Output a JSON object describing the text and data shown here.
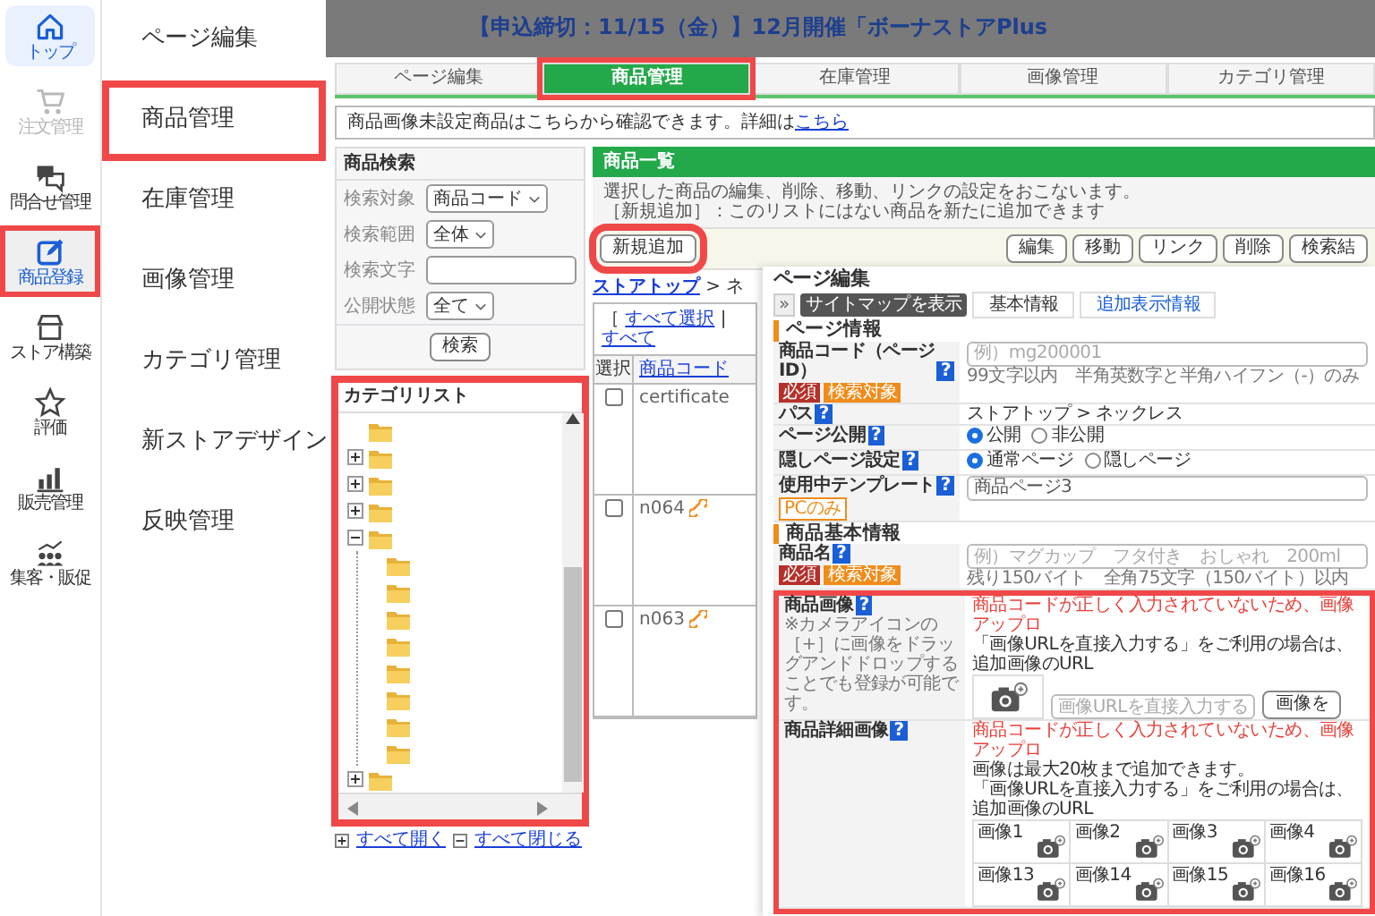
{
  "sidebar": {
    "items": [
      {
        "label": "トップ",
        "selected": true,
        "disabled": false,
        "highlighted": false
      },
      {
        "label": "注文管理",
        "selected": false,
        "disabled": true,
        "highlighted": false
      },
      {
        "label": "問合せ管理",
        "selected": false,
        "disabled": false,
        "highlighted": false
      },
      {
        "label": "商品登録",
        "selected": false,
        "disabled": false,
        "highlighted": true
      },
      {
        "label": "ストア構築",
        "selected": false,
        "disabled": false,
        "highlighted": false
      },
      {
        "label": "評価",
        "selected": false,
        "disabled": false,
        "highlighted": false
      },
      {
        "label": "販売管理",
        "selected": false,
        "disabled": false,
        "highlighted": false
      },
      {
        "label": "集客・販促",
        "selected": false,
        "disabled": false,
        "highlighted": false
      }
    ]
  },
  "submenu": {
    "items": [
      {
        "label": "ページ編集",
        "highlighted": false
      },
      {
        "label": "商品管理",
        "highlighted": true
      },
      {
        "label": "在庫管理",
        "highlighted": false
      },
      {
        "label": "画像管理",
        "highlighted": false
      },
      {
        "label": "カテゴリ管理",
        "highlighted": false
      },
      {
        "label": "新ストアデザイン",
        "highlighted": false
      },
      {
        "label": "反映管理",
        "highlighted": false
      }
    ]
  },
  "banner": {
    "text": "【申込締切：11/15（金）】12月開催「ボーナストアPlus"
  },
  "product_window": {
    "tabs": [
      {
        "label": "ページ編集",
        "selected": false,
        "highlighted": false
      },
      {
        "label": "商品管理",
        "selected": true,
        "highlighted": true
      },
      {
        "label": "在庫管理",
        "selected": false,
        "highlighted": false
      },
      {
        "label": "画像管理",
        "selected": false,
        "highlighted": false
      },
      {
        "label": "カテゴリ管理",
        "selected": false,
        "highlighted": false
      }
    ],
    "notice": {
      "text": "商品画像未設定商品はこちらから確認できます。詳細は",
      "link": "こちら"
    },
    "search": {
      "title": "商品検索",
      "fields": [
        {
          "label": "検索対象",
          "kind": "select",
          "value": "商品コード"
        },
        {
          "label": "検索範囲",
          "kind": "select",
          "value": "全体"
        },
        {
          "label": "検索文字",
          "kind": "text"
        },
        {
          "label": "公開状態",
          "kind": "select",
          "value": "全て"
        }
      ],
      "button": "検索"
    },
    "category_list": {
      "title": "カテゴリリスト",
      "highlighted": true,
      "tree": [
        {
          "expandable": false
        },
        {
          "expandable": true,
          "expanded": false
        },
        {
          "expandable": true,
          "expanded": false
        },
        {
          "expandable": true,
          "expanded": false
        },
        {
          "expandable": true,
          "expanded": true,
          "children": [
            {
              "expandable": false
            },
            {
              "expandable": false
            },
            {
              "expandable": false
            },
            {
              "expandable": false
            },
            {
              "expandable": false
            },
            {
              "expandable": false
            },
            {
              "expandable": false
            },
            {
              "expandable": false
            }
          ]
        },
        {
          "expandable": true,
          "expanded": false
        }
      ],
      "expand_all": "すべて開く",
      "collapse_all": "すべて閉じる"
    },
    "product_list": {
      "title": "商品一覧",
      "description": [
        "選択した商品の編集、削除、移動、リンクの設定をおこないます。",
        "［新規追加］：このリストにはない商品を新たに追加できます"
      ],
      "add_button": {
        "label": "新規追加",
        "highlighted": true
      },
      "actions": [
        "編集",
        "移動",
        "リンク",
        "削除",
        "検索結"
      ],
      "breadcrumb": {
        "link": "ストアトップ",
        "rest": "> ネ"
      },
      "select_bracket": "［",
      "select_links": [
        "すべて選択",
        "すべて"
      ],
      "separator": "|",
      "columns": [
        "選択",
        "商品コード"
      ],
      "rows": [
        {
          "code": "certificate",
          "checked": false,
          "linked": false
        },
        {
          "code": "n064",
          "checked": false,
          "linked": true
        },
        {
          "code": "n063",
          "checked": false,
          "linked": true
        }
      ]
    }
  },
  "page_edit": {
    "title": "ページ編集",
    "sitemap_button": "»",
    "tooltip": "サイトマップを表示",
    "tabs": [
      {
        "label": "基本情報",
        "selected": true
      },
      {
        "label": "追加表示情報",
        "selected": false
      }
    ],
    "sections": [
      {
        "title": "ページ情報",
        "rows": [
          {
            "kind": "input",
            "label": "商品コード（ページID）",
            "help": "?",
            "badges": [
              {
                "text": "必須",
                "color": "#b5302a",
                "outline": false
              },
              {
                "text": "検索対象",
                "color": "#f08c1a",
                "outline": false
              }
            ],
            "placeholder": "例）mg200001",
            "hint": "99文字以内　半角英数字と半角ハイフン（-）のみ",
            "highlighted": false
          },
          {
            "kind": "text",
            "label": "パス",
            "help": "?",
            "value": "ストアトップ > ネックレス",
            "highlighted": false
          },
          {
            "kind": "radio",
            "label": "ページ公開",
            "help": "?",
            "options": [
              {
                "label": "公開",
                "selected": true
              },
              {
                "label": "非公開",
                "selected": false
              }
            ],
            "highlighted": false
          },
          {
            "kind": "radio",
            "label": "隠しページ設定",
            "help": "?",
            "options": [
              {
                "label": "通常ページ",
                "selected": true
              },
              {
                "label": "隠しページ",
                "selected": false
              }
            ],
            "highlighted": false
          },
          {
            "kind": "select",
            "label": "使用中テンプレート",
            "help": "?",
            "badges": [
              {
                "text": "PCのみ",
                "color": "#f08c1a",
                "outline": true
              }
            ],
            "value": "商品ページ3",
            "highlighted": false
          }
        ]
      },
      {
        "title": "商品基本情報",
        "rows": [
          {
            "kind": "input",
            "label": "商品名",
            "help": "?",
            "badges": [
              {
                "text": "必須",
                "color": "#b5302a",
                "outline": false
              },
              {
                "text": "検索対象",
                "color": "#f08c1a",
                "outline": false
              }
            ],
            "placeholder": "例）マグカップ　フタ付き　おしゃれ　200ml",
            "hint": "残り150バイト　全角75文字（150バイト）以内",
            "highlighted": false
          },
          {
            "kind": "image",
            "label": "商品画像",
            "help": "?",
            "note": "※カメラアイコンの［+］に画像をドラッグアンドドロップすることでも登録が可能です。",
            "error": "商品コードが正しく入力されていないため、画像アップロ",
            "info": [
              "「画像URLを直接入力する」をご利用の場合は、追加画像のURL"
            ],
            "url_placeholder": "画像URLを直接入力する",
            "url_button": "画像を",
            "highlighted": true
          },
          {
            "kind": "images",
            "label": "商品詳細画像",
            "help": "?",
            "error": "商品コードが正しく入力されていないため、画像アップロ",
            "info": [
              "画像は最大20枚まで追加できます。",
              "「画像URLを直接入力する」をご利用の場合は、追加画像のURL"
            ],
            "slots": [
              "画像1",
              "画像2",
              "画像3",
              "画像4",
              "画像13",
              "画像14",
              "画像15",
              "画像16"
            ],
            "highlighted": true
          }
        ]
      }
    ]
  }
}
